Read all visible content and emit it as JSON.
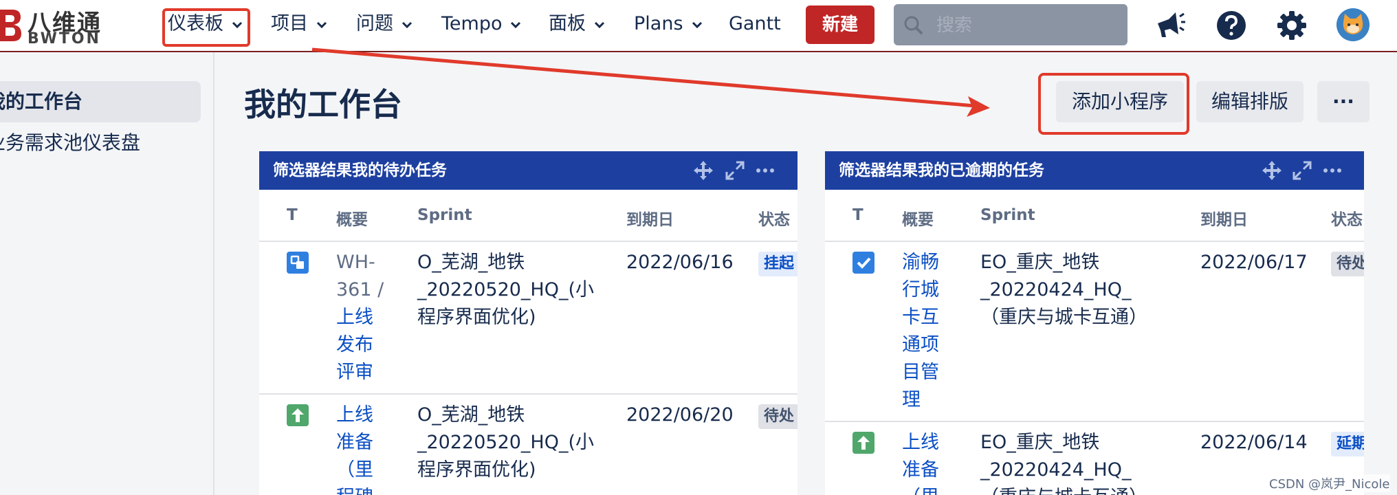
{
  "logo": {
    "cn": "八维通",
    "en": "BWTON"
  },
  "nav": {
    "items": [
      "仪表板",
      "项目",
      "问题",
      "Tempo",
      "面板",
      "Plans",
      "Gantt"
    ],
    "create": "新建",
    "search_placeholder": "搜索"
  },
  "sidebar": {
    "items": [
      "我的工作台",
      "业务需求池仪表盘"
    ]
  },
  "page": {
    "title": "我的工作台",
    "add_gadget": "添加小程序",
    "edit_layout": "编辑排版",
    "more": "···"
  },
  "gadget_left": {
    "title": "筛选器结果我的待办任务",
    "columns": [
      "T",
      "概要",
      "Sprint",
      "到期日",
      "状态"
    ],
    "rows": [
      {
        "type_icon": "subtask-icon",
        "key_lines": [
          "WH-",
          "361 /"
        ],
        "summary_lines": [
          "上线",
          "发布",
          "评审"
        ],
        "sprint_lines": [
          "O_芜湖_地铁",
          "_20220520_HQ_(小",
          "程序界面优化)"
        ],
        "due": "2022/06/16",
        "status": "挂起"
      },
      {
        "type_icon": "story-arrow-icon",
        "summary_lines": [
          "上线",
          "准备",
          "（里",
          "程碑"
        ],
        "sprint_lines": [
          "O_芜湖_地铁",
          "_20220520_HQ_(小",
          "程序界面优化)"
        ],
        "due": "2022/06/20",
        "status": "待处"
      }
    ]
  },
  "gadget_right": {
    "title": "筛选器结果我的已逾期的任务",
    "columns": [
      "T",
      "概要",
      "Sprint",
      "到期日",
      "状态"
    ],
    "rows": [
      {
        "type_icon": "task-check-icon",
        "summary_lines": [
          "渝畅",
          "行城",
          "卡互",
          "通项",
          "目管",
          "理"
        ],
        "sprint_lines": [
          "EO_重庆_地铁",
          "_20220424_HQ_",
          "（重庆与城卡互通）"
        ],
        "due": "2022/06/17",
        "status": "待处"
      },
      {
        "type_icon": "story-arrow-icon",
        "summary_lines": [
          "上线",
          "准备",
          "（里"
        ],
        "sprint_lines": [
          "EO_重庆_地铁",
          "_20220424_HQ_",
          "（重庆与城卡互通）"
        ],
        "due": "2022/06/14",
        "status": "延期"
      }
    ]
  },
  "watermark": "CSDN @岚尹_Nicole",
  "colors": {
    "brand_red": "#c02626",
    "gadget_header": "#1d40a0",
    "link": "#0b4fc4",
    "annotation": "#e03a2b"
  }
}
